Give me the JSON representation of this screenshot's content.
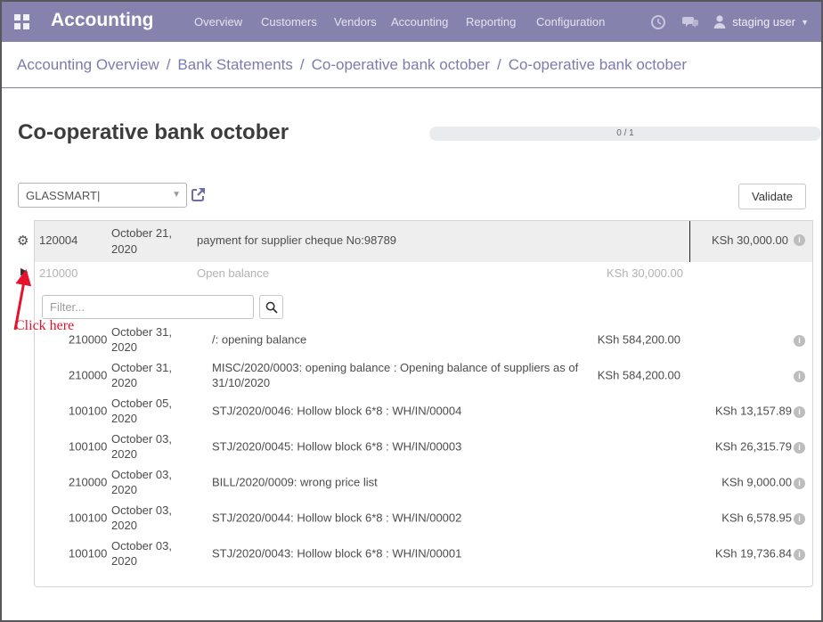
{
  "colors": {
    "navbar_bg": "#8583ad",
    "breadcrumb_link": "#7c7bad",
    "annotation_red": "#e8112d",
    "accent_purple": "#6f6da4"
  },
  "navbar": {
    "brand": "Accounting",
    "menu": [
      "Overview",
      "Customers",
      "Vendors",
      "Accounting",
      "Reporting",
      "Configuration"
    ],
    "user_name": "staging user"
  },
  "breadcrumb": {
    "separator": "/",
    "items": [
      "Accounting Overview",
      "Bank Statements",
      "Co-operative bank october",
      "Co-operative bank october"
    ]
  },
  "page": {
    "title": "Co-operative bank october",
    "pager": "0 / 1"
  },
  "toolbar": {
    "partner_value": "GLASSMART|",
    "validate_label": "Validate"
  },
  "statement": {
    "ref": "120004",
    "date": "October 21, 2020",
    "label": "payment for supplier cheque No:98789",
    "amount": "KSh 30,000.00"
  },
  "open_balance": {
    "account": "210000",
    "label": "Open balance",
    "amount": "KSh 30,000.00"
  },
  "filter": {
    "placeholder": "Filter..."
  },
  "annotation": {
    "label": "Click here"
  },
  "lines": [
    {
      "account": "210000",
      "date_l1": "October 31,",
      "date_l2": "2020",
      "label": "/: opening balance",
      "debit": "KSh 584,200.00",
      "credit": ""
    },
    {
      "account": "210000",
      "date_l1": "October 31,",
      "date_l2": "2020",
      "label": "MISC/2020/0003: opening balance : Opening balance of suppliers as of 31/10/2020",
      "debit": "KSh 584,200.00",
      "credit": ""
    },
    {
      "account": "100100",
      "date_l1": "October 05,",
      "date_l2": "2020",
      "label": "STJ/2020/0046: Hollow block 6*8 : WH/IN/00004",
      "debit": "",
      "credit": "KSh 13,157.89"
    },
    {
      "account": "100100",
      "date_l1": "October 03,",
      "date_l2": "2020",
      "label": "STJ/2020/0045: Hollow block 6*8 : WH/IN/00003",
      "debit": "",
      "credit": "KSh 26,315.79"
    },
    {
      "account": "210000",
      "date_l1": "October 03,",
      "date_l2": "2020",
      "label": "BILL/2020/0009: wrong price list",
      "debit": "",
      "credit": "KSh 9,000.00"
    },
    {
      "account": "100100",
      "date_l1": "October 03,",
      "date_l2": "2020",
      "label": "STJ/2020/0044: Hollow block 6*8 : WH/IN/00002",
      "debit": "",
      "credit": "KSh 6,578.95"
    },
    {
      "account": "100100",
      "date_l1": "October 03,",
      "date_l2": "2020",
      "label": "STJ/2020/0043: Hollow block 6*8 : WH/IN/00001",
      "debit": "",
      "credit": "KSh 19,736.84"
    }
  ]
}
